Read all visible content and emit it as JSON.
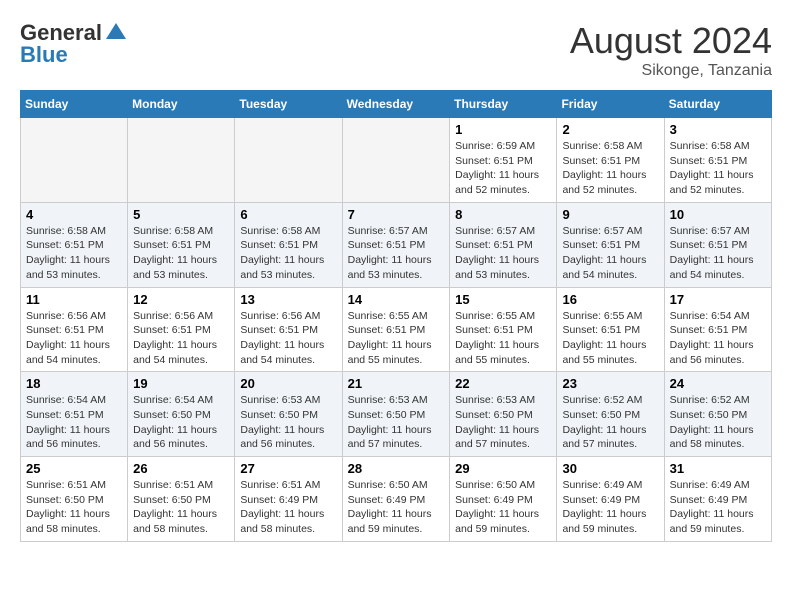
{
  "header": {
    "logo_general": "General",
    "logo_blue": "Blue",
    "month_year": "August 2024",
    "location": "Sikonge, Tanzania"
  },
  "days_of_week": [
    "Sunday",
    "Monday",
    "Tuesday",
    "Wednesday",
    "Thursday",
    "Friday",
    "Saturday"
  ],
  "weeks": [
    [
      {
        "day": "",
        "info": ""
      },
      {
        "day": "",
        "info": ""
      },
      {
        "day": "",
        "info": ""
      },
      {
        "day": "",
        "info": ""
      },
      {
        "day": "1",
        "info": "Sunrise: 6:59 AM\nSunset: 6:51 PM\nDaylight: 11 hours\nand 52 minutes."
      },
      {
        "day": "2",
        "info": "Sunrise: 6:58 AM\nSunset: 6:51 PM\nDaylight: 11 hours\nand 52 minutes."
      },
      {
        "day": "3",
        "info": "Sunrise: 6:58 AM\nSunset: 6:51 PM\nDaylight: 11 hours\nand 52 minutes."
      }
    ],
    [
      {
        "day": "4",
        "info": "Sunrise: 6:58 AM\nSunset: 6:51 PM\nDaylight: 11 hours\nand 53 minutes."
      },
      {
        "day": "5",
        "info": "Sunrise: 6:58 AM\nSunset: 6:51 PM\nDaylight: 11 hours\nand 53 minutes."
      },
      {
        "day": "6",
        "info": "Sunrise: 6:58 AM\nSunset: 6:51 PM\nDaylight: 11 hours\nand 53 minutes."
      },
      {
        "day": "7",
        "info": "Sunrise: 6:57 AM\nSunset: 6:51 PM\nDaylight: 11 hours\nand 53 minutes."
      },
      {
        "day": "8",
        "info": "Sunrise: 6:57 AM\nSunset: 6:51 PM\nDaylight: 11 hours\nand 53 minutes."
      },
      {
        "day": "9",
        "info": "Sunrise: 6:57 AM\nSunset: 6:51 PM\nDaylight: 11 hours\nand 54 minutes."
      },
      {
        "day": "10",
        "info": "Sunrise: 6:57 AM\nSunset: 6:51 PM\nDaylight: 11 hours\nand 54 minutes."
      }
    ],
    [
      {
        "day": "11",
        "info": "Sunrise: 6:56 AM\nSunset: 6:51 PM\nDaylight: 11 hours\nand 54 minutes."
      },
      {
        "day": "12",
        "info": "Sunrise: 6:56 AM\nSunset: 6:51 PM\nDaylight: 11 hours\nand 54 minutes."
      },
      {
        "day": "13",
        "info": "Sunrise: 6:56 AM\nSunset: 6:51 PM\nDaylight: 11 hours\nand 54 minutes."
      },
      {
        "day": "14",
        "info": "Sunrise: 6:55 AM\nSunset: 6:51 PM\nDaylight: 11 hours\nand 55 minutes."
      },
      {
        "day": "15",
        "info": "Sunrise: 6:55 AM\nSunset: 6:51 PM\nDaylight: 11 hours\nand 55 minutes."
      },
      {
        "day": "16",
        "info": "Sunrise: 6:55 AM\nSunset: 6:51 PM\nDaylight: 11 hours\nand 55 minutes."
      },
      {
        "day": "17",
        "info": "Sunrise: 6:54 AM\nSunset: 6:51 PM\nDaylight: 11 hours\nand 56 minutes."
      }
    ],
    [
      {
        "day": "18",
        "info": "Sunrise: 6:54 AM\nSunset: 6:51 PM\nDaylight: 11 hours\nand 56 minutes."
      },
      {
        "day": "19",
        "info": "Sunrise: 6:54 AM\nSunset: 6:50 PM\nDaylight: 11 hours\nand 56 minutes."
      },
      {
        "day": "20",
        "info": "Sunrise: 6:53 AM\nSunset: 6:50 PM\nDaylight: 11 hours\nand 56 minutes."
      },
      {
        "day": "21",
        "info": "Sunrise: 6:53 AM\nSunset: 6:50 PM\nDaylight: 11 hours\nand 57 minutes."
      },
      {
        "day": "22",
        "info": "Sunrise: 6:53 AM\nSunset: 6:50 PM\nDaylight: 11 hours\nand 57 minutes."
      },
      {
        "day": "23",
        "info": "Sunrise: 6:52 AM\nSunset: 6:50 PM\nDaylight: 11 hours\nand 57 minutes."
      },
      {
        "day": "24",
        "info": "Sunrise: 6:52 AM\nSunset: 6:50 PM\nDaylight: 11 hours\nand 58 minutes."
      }
    ],
    [
      {
        "day": "25",
        "info": "Sunrise: 6:51 AM\nSunset: 6:50 PM\nDaylight: 11 hours\nand 58 minutes."
      },
      {
        "day": "26",
        "info": "Sunrise: 6:51 AM\nSunset: 6:50 PM\nDaylight: 11 hours\nand 58 minutes."
      },
      {
        "day": "27",
        "info": "Sunrise: 6:51 AM\nSunset: 6:49 PM\nDaylight: 11 hours\nand 58 minutes."
      },
      {
        "day": "28",
        "info": "Sunrise: 6:50 AM\nSunset: 6:49 PM\nDaylight: 11 hours\nand 59 minutes."
      },
      {
        "day": "29",
        "info": "Sunrise: 6:50 AM\nSunset: 6:49 PM\nDaylight: 11 hours\nand 59 minutes."
      },
      {
        "day": "30",
        "info": "Sunrise: 6:49 AM\nSunset: 6:49 PM\nDaylight: 11 hours\nand 59 minutes."
      },
      {
        "day": "31",
        "info": "Sunrise: 6:49 AM\nSunset: 6:49 PM\nDaylight: 11 hours\nand 59 minutes."
      }
    ]
  ]
}
